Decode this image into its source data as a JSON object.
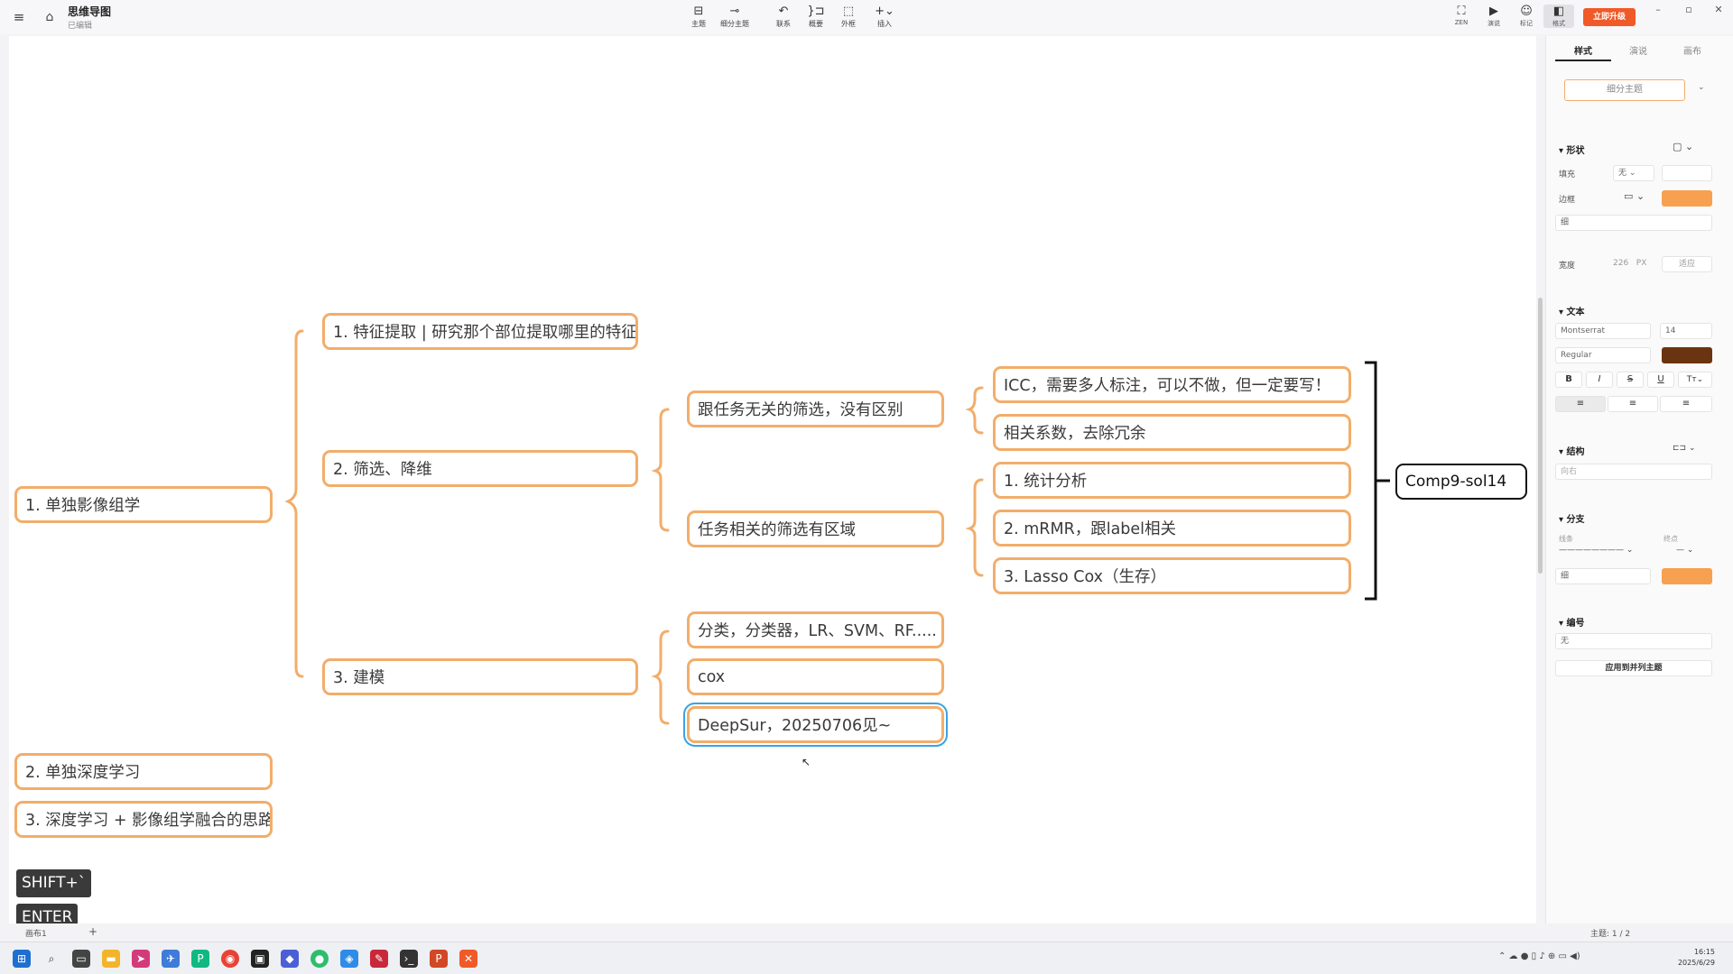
{
  "app": {
    "title": "思维导图",
    "subtitle": "已编辑",
    "upgrade_label": "立即升级"
  },
  "toolbar": {
    "tools": [
      {
        "label": "主题",
        "icon": "topic-icon"
      },
      {
        "label": "细分主题",
        "icon": "subtopic-icon"
      },
      {
        "label": "联系",
        "icon": "relationship-icon"
      },
      {
        "label": "概要",
        "icon": "summary-icon"
      },
      {
        "label": "外框",
        "icon": "boundary-icon"
      },
      {
        "label": "插入",
        "icon": "insert-icon"
      }
    ],
    "right_tools": [
      {
        "label": "ZEN",
        "icon": "fullscreen-icon"
      },
      {
        "label": "演说",
        "icon": "present-icon"
      },
      {
        "label": "标记",
        "icon": "emoji-icon"
      },
      {
        "label": "格式",
        "icon": "panel-icon"
      }
    ]
  },
  "mindmap": {
    "root_topics": [
      "1. 单独影像组学",
      "2. 单独深度学习",
      "3. 深度学习 + 影像组学融合的思路"
    ],
    "level1": [
      "1. 特征提取 | 研究那个部位提取哪里的特征",
      "2. 筛选、降维",
      "3. 建模"
    ],
    "filter_children": [
      "跟任务无关的筛选，没有区别",
      "任务相关的筛选有区域"
    ],
    "unrelated_children": [
      "ICC，需要多人标注，可以不做，但一定要写！",
      "相关系数，去除冗余"
    ],
    "related_children": [
      "1. 统计分析",
      "2. mRMR，跟label相关",
      "3. Lasso Cox（生存）"
    ],
    "model_children": [
      "分类，分类器，LR、SVM、RF.....",
      "cox",
      "DeepSur，20250706见~"
    ],
    "summary": "Comp9-sol14"
  },
  "keys": [
    "SHIFT+`",
    "ENTER"
  ],
  "panel": {
    "tabs": [
      "样式",
      "演说",
      "画布"
    ],
    "active_tab": "样式",
    "style_preset": "细分主题",
    "shape_section": "形状",
    "fill_label": "填充",
    "fill_value": "无",
    "border_label": "边框",
    "border_color": "#f7a04f",
    "border_weight": "细",
    "width_label": "宽度",
    "width_value": "226",
    "width_unit": "PX",
    "width_fit": "适应",
    "text_section": "文本",
    "font_family": "Montserrat",
    "font_size": "14",
    "font_weight": "Regular",
    "text_color": "#6b3410",
    "structure_section": "结构",
    "structure_value": "向右",
    "branch_section": "分支",
    "line_label": "线条",
    "end_label": "终点",
    "branch_weight": "细",
    "branch_color": "#f7a04f",
    "numbering_section": "编号",
    "numbering_value": "无",
    "apply_label": "应用到并列主题"
  },
  "status": {
    "sheet": "画布1",
    "topics": "主题: 1 / 2"
  },
  "clock": {
    "time": "16:15",
    "date": "2025/6/29"
  },
  "colors": {
    "accent": "#f05a28",
    "node_border": "#f2ad6b",
    "selection": "#3aa3e3"
  }
}
